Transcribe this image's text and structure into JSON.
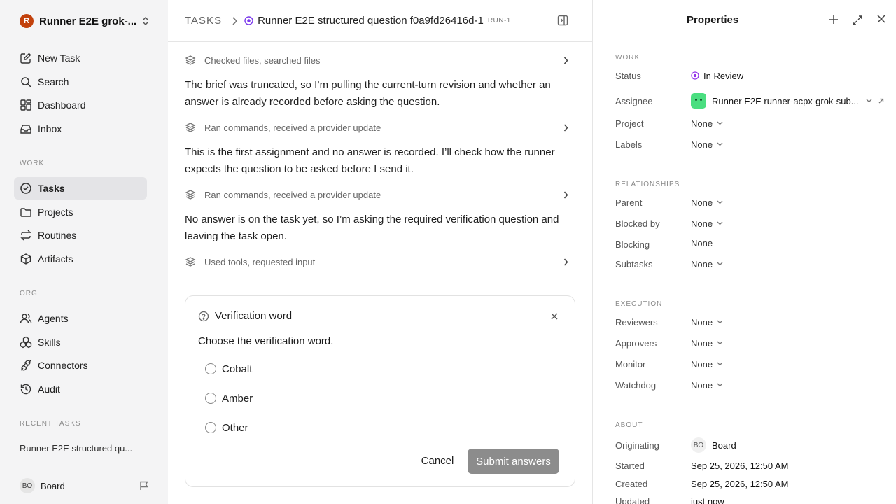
{
  "workspace": {
    "logo": "R",
    "name": "Runner E2E grok-..."
  },
  "nav": {
    "new_task": "New Task",
    "search": "Search",
    "dashboard": "Dashboard",
    "inbox": "Inbox"
  },
  "sections": {
    "work": "WORK",
    "org": "ORG",
    "recent": "RECENT TASKS"
  },
  "work_nav": {
    "tasks": "Tasks",
    "projects": "Projects",
    "routines": "Routines",
    "artifacts": "Artifacts"
  },
  "org_nav": {
    "agents": "Agents",
    "skills": "Skills",
    "connectors": "Connectors",
    "audit": "Audit"
  },
  "recent_task": "Runner E2E structured qu...",
  "user": {
    "initials": "BO",
    "name": "Board"
  },
  "breadcrumb": {
    "root": "TASKS",
    "title": "Runner E2E structured question f0a9fd26416d-1",
    "run": "RUN-1"
  },
  "activity": {
    "a1": "Checked files, searched files",
    "p1": "The brief was truncated, so I’m pulling the current-turn revision and whether an answer is already recorded before asking the question.",
    "a2": "Ran commands, received a provider update",
    "p2": "This is the first assignment and no answer is recorded. I’ll check how the runner expects the question to be asked before I send it.",
    "a3": "Ran commands, received a provider update",
    "p3": "No answer is on the task yet, so I’m asking the required verification question and leaving the task open.",
    "a4": "Used tools, requested input"
  },
  "question": {
    "title": "Verification word",
    "prompt": "Choose the verification word.",
    "options": [
      "Cobalt",
      "Amber",
      "Other"
    ],
    "cancel": "Cancel",
    "submit": "Submit answers"
  },
  "properties": {
    "title": "Properties",
    "sections": {
      "work": "WORK",
      "relationships": "RELATIONSHIPS",
      "execution": "EXECUTION",
      "about": "ABOUT"
    },
    "labels": {
      "status": "Status",
      "assignee": "Assignee",
      "project": "Project",
      "labels": "Labels",
      "parent": "Parent",
      "blocked_by": "Blocked by",
      "blocking": "Blocking",
      "subtasks": "Subtasks",
      "reviewers": "Reviewers",
      "approvers": "Approvers",
      "monitor": "Monitor",
      "watchdog": "Watchdog",
      "originating": "Originating",
      "started": "Started",
      "created": "Created",
      "updated": "Updated"
    },
    "values": {
      "status": "In Review",
      "assignee": "Runner E2E runner-acpx-grok-sub...",
      "project": "None",
      "labels": "None",
      "parent": "None",
      "blocked_by": "None",
      "blocking": "None",
      "subtasks": "None",
      "reviewers": "None",
      "approvers": "None",
      "monitor": "None",
      "watchdog": "None",
      "originating_initials": "BO",
      "originating": "Board",
      "started": "Sep 25, 2026, 12:50 AM",
      "created": "Sep 25, 2026, 12:50 AM",
      "updated": "just now"
    }
  }
}
